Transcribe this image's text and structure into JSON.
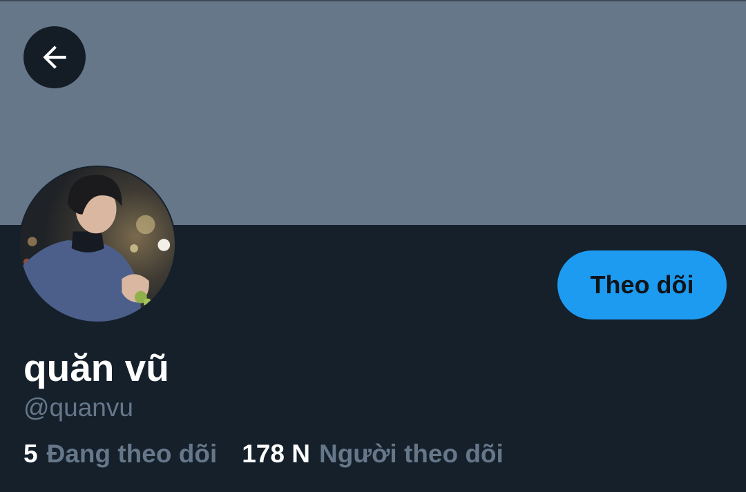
{
  "header": {
    "back_icon": "arrow-left-icon",
    "banner_color": "#66778a"
  },
  "profile": {
    "avatar": "profile-photo",
    "display_name": "quăn vũ",
    "handle": "@quanvu",
    "follow_button_label": "Theo dõi",
    "accent_color": "#1d9bf0",
    "stats": {
      "following_count": "5",
      "following_label": "Đang theo dõi",
      "followers_count": "178 N",
      "followers_label": "Người theo dõi"
    }
  }
}
